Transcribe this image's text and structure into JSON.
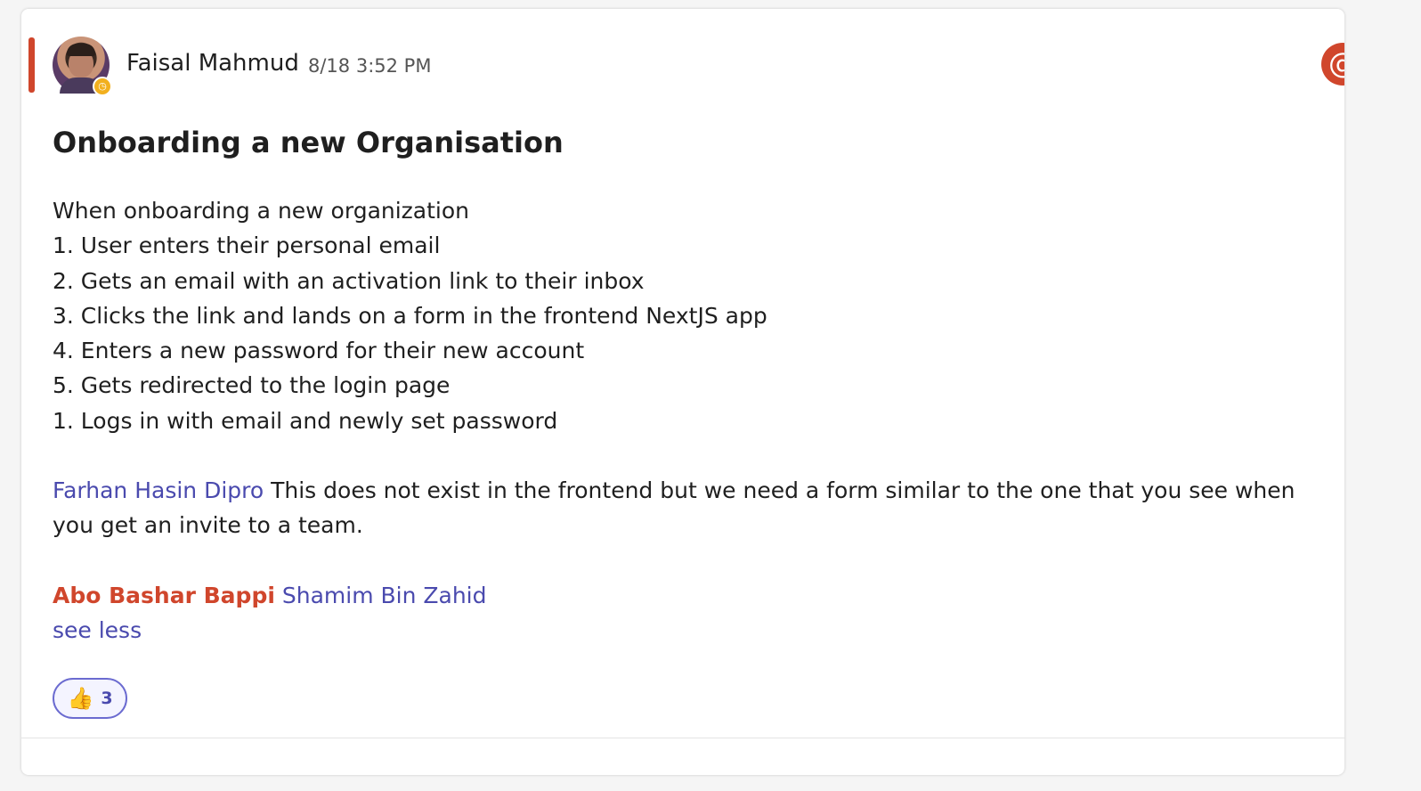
{
  "message": {
    "author": "Faisal Mahmud",
    "timestamp": "8/18 3:52 PM",
    "mention_symbol": "@",
    "title": "Onboarding a new Organisation",
    "lines": [
      "When onboarding a new organization",
      "1. User enters their personal email",
      "2. Gets an email with an activation link to their inbox",
      "3. Clicks the link and lands on a form in the frontend NextJS app",
      "4. Enters a new password for their new account",
      "5. Gets redirected to the login page",
      "1. Logs in with email and newly set password"
    ],
    "paragraph": {
      "mention": "Farhan Hasin Dipro",
      "text": " This does not exist in the frontend but we need a form similar to the one that you see when you get an invite to a team."
    },
    "mentions": {
      "self": "Abo Bashar Bappi",
      "other": "Shamim Bin Zahid"
    },
    "see_less": "see less",
    "reaction": {
      "emoji": "👍",
      "count": "3"
    }
  },
  "colors": {
    "accent": "#d0462c",
    "link": "#4a4aae",
    "status": "#f2b01e"
  },
  "icons": {
    "status": "clock-icon",
    "mention": "at-icon"
  }
}
